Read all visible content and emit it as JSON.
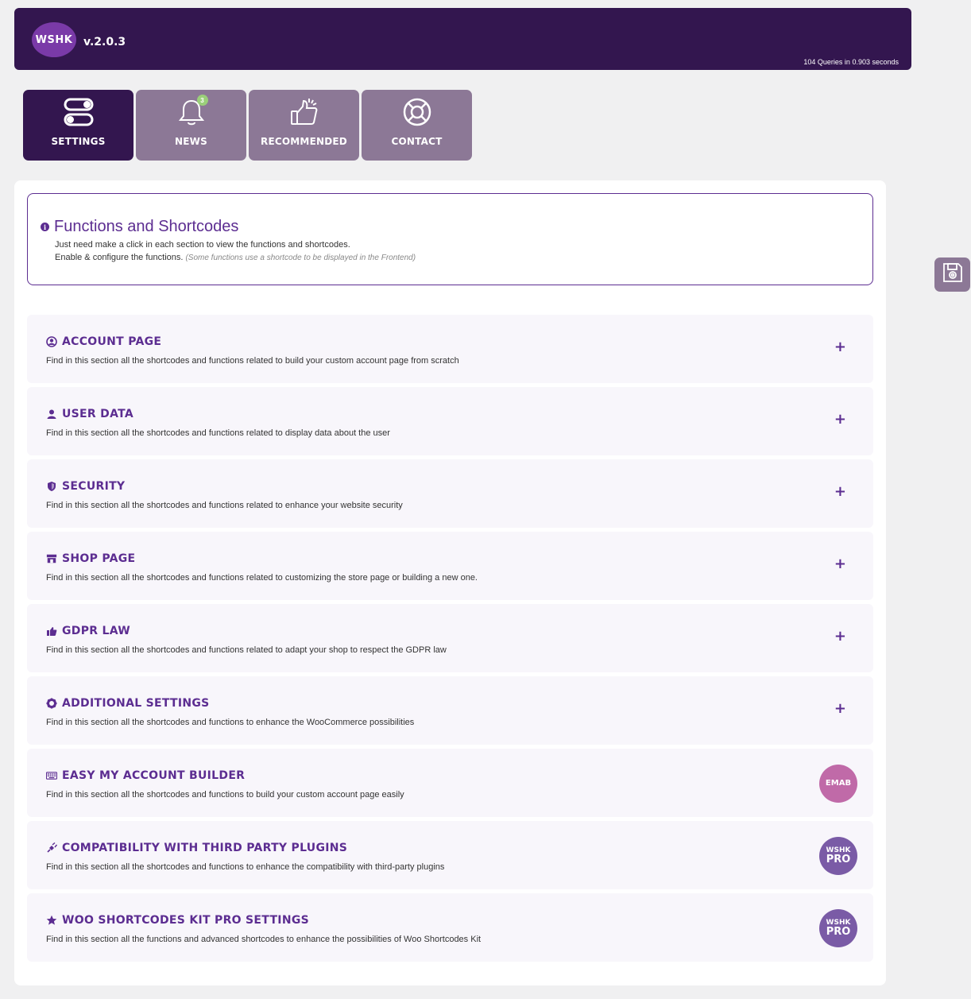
{
  "header": {
    "logo_text": "WSHK",
    "version": "v.2.0.3",
    "queries": "104 Queries in 0.903 seconds",
    "background": "#33164f"
  },
  "tabs": [
    {
      "label": "SETTINGS",
      "icon": "toggles-icon",
      "active": true
    },
    {
      "label": "NEWS",
      "icon": "bell-icon",
      "badge": "3"
    },
    {
      "label": "RECOMMENDED",
      "icon": "thumbs-up-icon"
    },
    {
      "label": "CONTACT",
      "icon": "lifebuoy-icon"
    }
  ],
  "intro": {
    "title": "Functions and Shortcodes",
    "line1": "Just need make a click in each section to view the functions and shortcodes.",
    "line2": "Enable & configure the functions.",
    "note": "(Some functions use a shortcode to be displayed in the Frontend)"
  },
  "sections": [
    {
      "title": "ACCOUNT PAGE",
      "desc": "Find in this section all the shortcodes and functions related to build your custom account page from scratch",
      "icon": "account-circle-icon",
      "action": "+"
    },
    {
      "title": "USER DATA",
      "desc": "Find in this section all the shortcodes and functions related to display data about the user",
      "icon": "user-icon",
      "action": "+"
    },
    {
      "title": "SECURITY",
      "desc": "Find in this section all the shortcodes and functions related to enhance your website security",
      "icon": "shield-icon",
      "action": "+"
    },
    {
      "title": "SHOP PAGE",
      "desc": "Find in this section all the shortcodes and functions related to customizing the store page or building a new one.",
      "icon": "store-icon",
      "action": "+"
    },
    {
      "title": "GDPR LAW",
      "desc": "Find in this section all the shortcodes and functions related to adapt your shop to respect the GDPR law",
      "icon": "thumbs-up-icon",
      "action": "+"
    },
    {
      "title": "ADDITIONAL SETTINGS",
      "desc": "Find in this section all the shortcodes and functions to enhance the WooCommerce possibilities",
      "icon": "gear-icon",
      "action": "+"
    },
    {
      "title": "EASY MY ACCOUNT BUILDER",
      "desc": "Find in this section all the shortcodes and functions to build your custom account page easily",
      "icon": "keyboard-icon",
      "badge_main": "EMAB"
    },
    {
      "title": "COMPATIBILITY WITH THIRD PARTY PLUGINS",
      "desc": "Find in this section all the shortcodes and functions to enhance the compatibility with third-party plugins",
      "icon": "plug-icon",
      "badge_top": "WSHK",
      "badge_main": "PRO"
    },
    {
      "title": "WOO SHORTCODES KIT PRO SETTINGS",
      "desc": "Find in this section all the functions and advanced shortcodes to enhance the possibilities of Woo Shortcodes Kit",
      "icon": "star-icon",
      "badge_top": "WSHK",
      "badge_main": "PRO"
    }
  ],
  "colors": {
    "accent": "#5c2d91",
    "tab_inactive": "#8c7896",
    "section_bg": "#f8f6fb",
    "emab": "#c06aa8",
    "pro": "#7a5ba6"
  }
}
